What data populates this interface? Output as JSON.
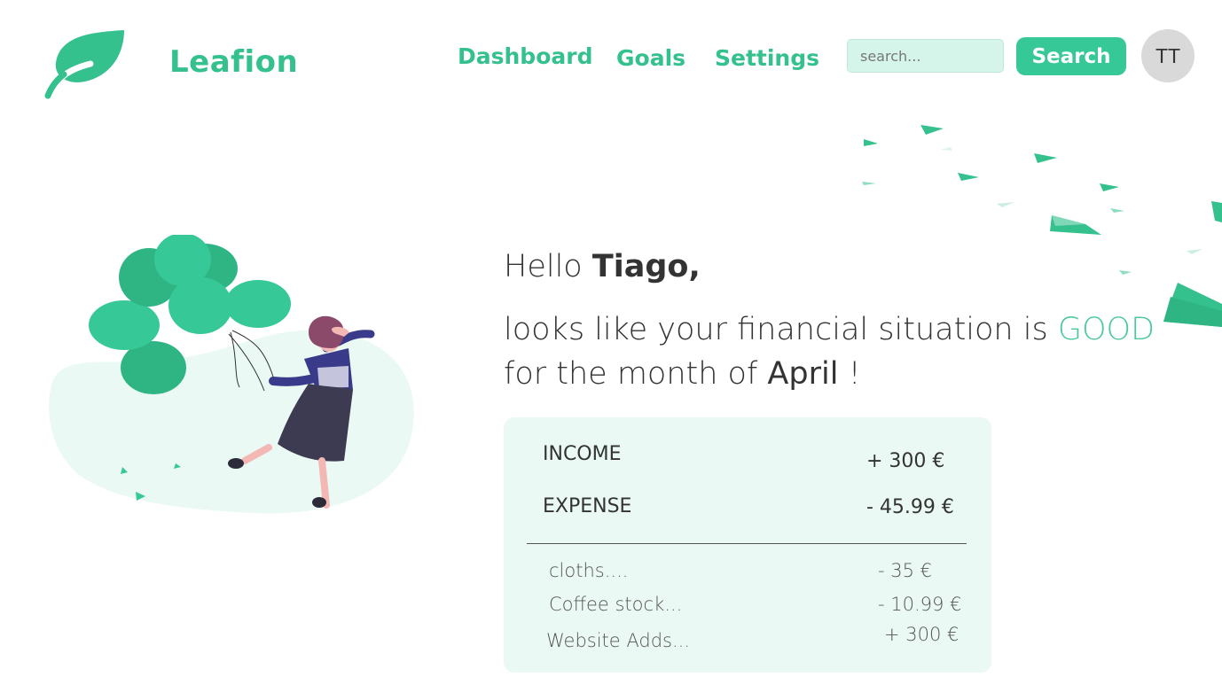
{
  "header": {
    "brand": "Leafion",
    "nav": {
      "dashboard": "Dashboard",
      "goals": "Goals",
      "settings": "Settings"
    },
    "search": {
      "placeholder": "search...",
      "button_label": "Search"
    },
    "avatar_initials": "TT"
  },
  "greeting": {
    "hello": "Hello",
    "name": "Tiago,",
    "status_prefix": "looks like your financial situation is",
    "status": "GOOD",
    "month_prefix": "for the month of",
    "month": "April",
    "month_suffix": "!"
  },
  "summary": {
    "income_label": "INCOME",
    "income_value": "+ 300 €",
    "expense_label": "EXPENSE",
    "expense_value": "- 45.99 €",
    "items": [
      {
        "label": "cloths....",
        "value": "- 35 €"
      },
      {
        "label": "Coffee stock...",
        "value": "- 10.99 €"
      },
      {
        "label": "Website Adds...",
        "value": "+ 300 €"
      }
    ]
  },
  "colors": {
    "accent": "#34c18e",
    "button": "#36c997",
    "card_bg": "#eaf9f3",
    "search_bg": "#d6f5ea"
  },
  "icons": [
    "leaf-logo-icon",
    "paper-plane-icon",
    "balloon-woman-illustration"
  ]
}
